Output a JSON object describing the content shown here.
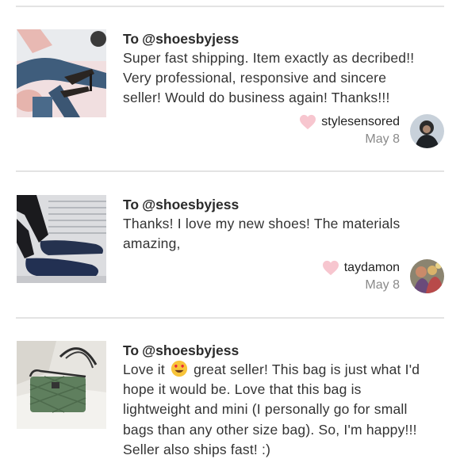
{
  "reviews": [
    {
      "to_prefix": "To",
      "to_handle": "@shoesbyjess",
      "lines": [
        "Super fast shipping. Item exactly as decribed!!",
        "Very professional, responsive and sincere",
        "seller! Would do business again! Thanks!!!"
      ],
      "username": "stylesensored",
      "date": "May 8",
      "thumb_icon": "stiletto-heels-photo",
      "avatar_icon": "user-avatar-photo"
    },
    {
      "to_prefix": "To",
      "to_handle": "@shoesbyjess",
      "lines": [
        "Thanks! I love my new shoes! The materials",
        "amazing,"
      ],
      "username": "taydamon",
      "date": "May 8",
      "thumb_icon": "woven-loafers-photo",
      "avatar_icon": "user-avatar-photo"
    },
    {
      "to_prefix": "To",
      "to_handle": "@shoesbyjess",
      "line1_before": "Love it",
      "line1_after": "great seller! This bag is just what I'd",
      "lines": [
        "hope it would be. Love that this bag is",
        "lightweight and mini (I personally go for small",
        "bags than any other size bag). So, I'm happy!!!",
        "Seller also ships fast! :)"
      ],
      "thumb_icon": "green-quilted-bag-photo",
      "emoji_icon": "heart-eyes-emoji"
    }
  ],
  "colors": {
    "heart": "#f7c6cf",
    "divider": "#e3e3e3",
    "date": "#8a8a8a"
  }
}
